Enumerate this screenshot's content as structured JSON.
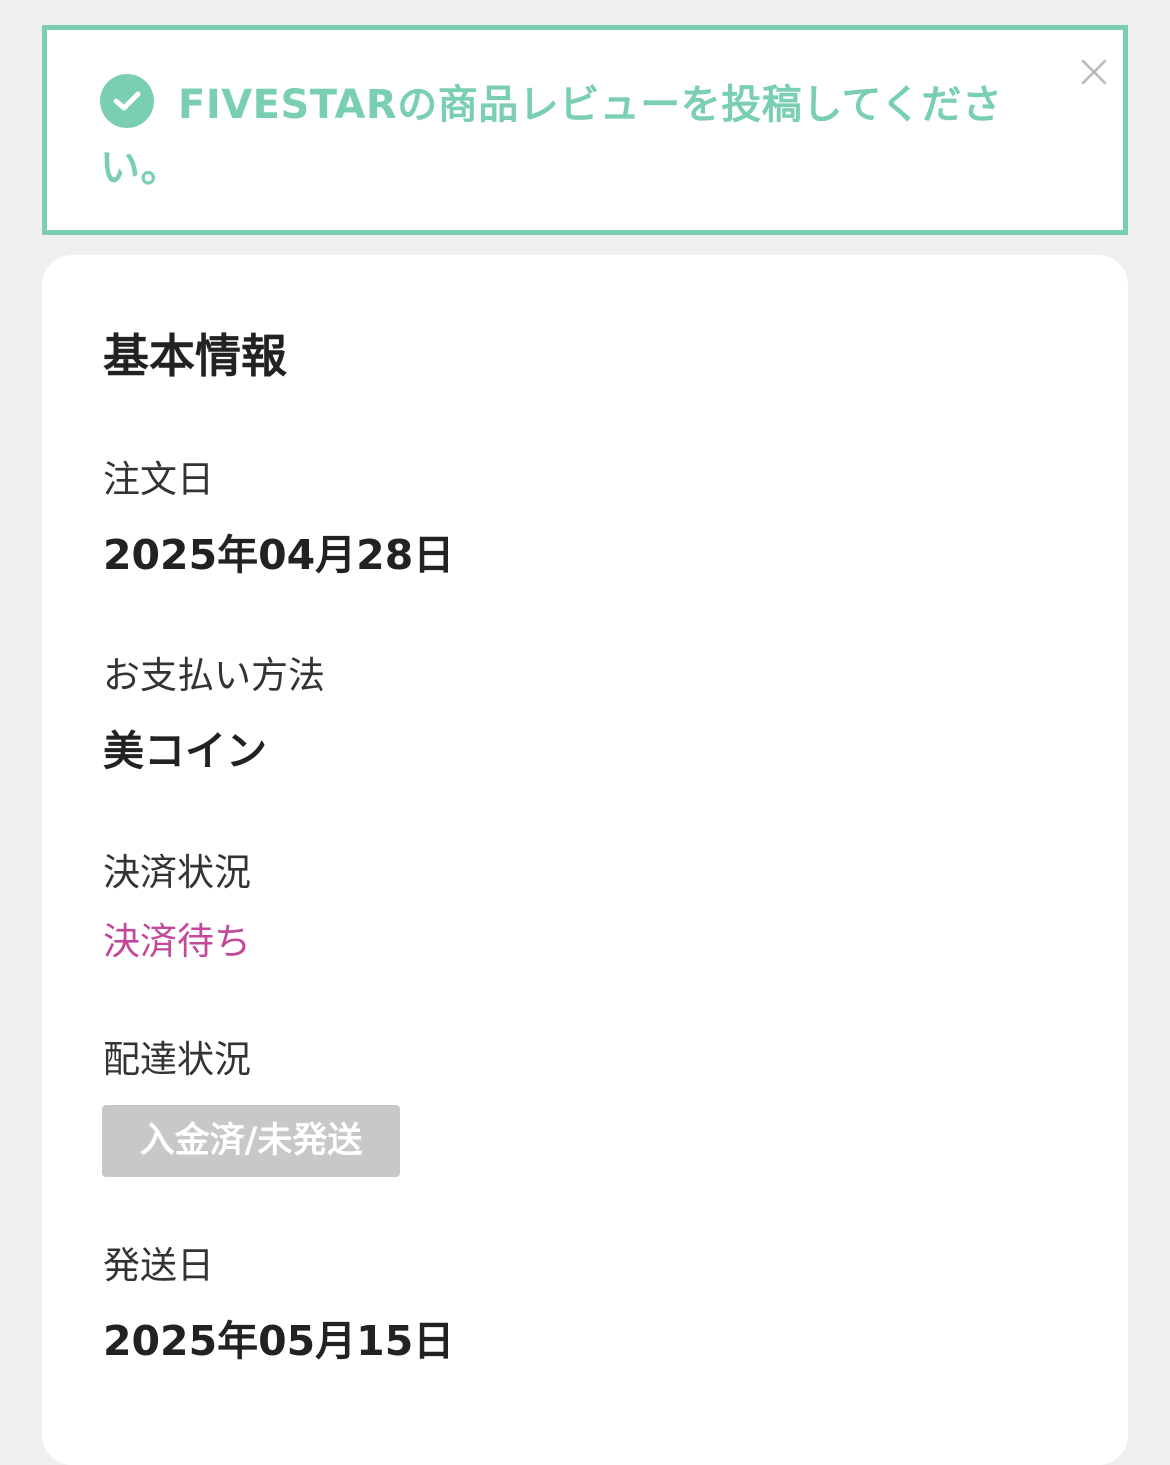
{
  "notice": {
    "message": "FIVESTARの商品レビューを投稿してください。",
    "icon": "check-circle-icon",
    "close_icon": "close-icon",
    "accent_color": "#7bcfb1"
  },
  "basic_info": {
    "title": "基本情報",
    "order_date": {
      "label": "注文日",
      "value": "2025年04月28日"
    },
    "payment_method": {
      "label": "お支払い方法",
      "value": "美コイン"
    },
    "payment_status": {
      "label": "決済状況",
      "value": "決済待ち",
      "color": "#c4489a"
    },
    "delivery_status": {
      "label": "配達状況",
      "value": "入金済/未発送",
      "badge_color": "#c8c8c8"
    },
    "ship_date": {
      "label": "発送日",
      "value": "2025年05月15日"
    }
  }
}
